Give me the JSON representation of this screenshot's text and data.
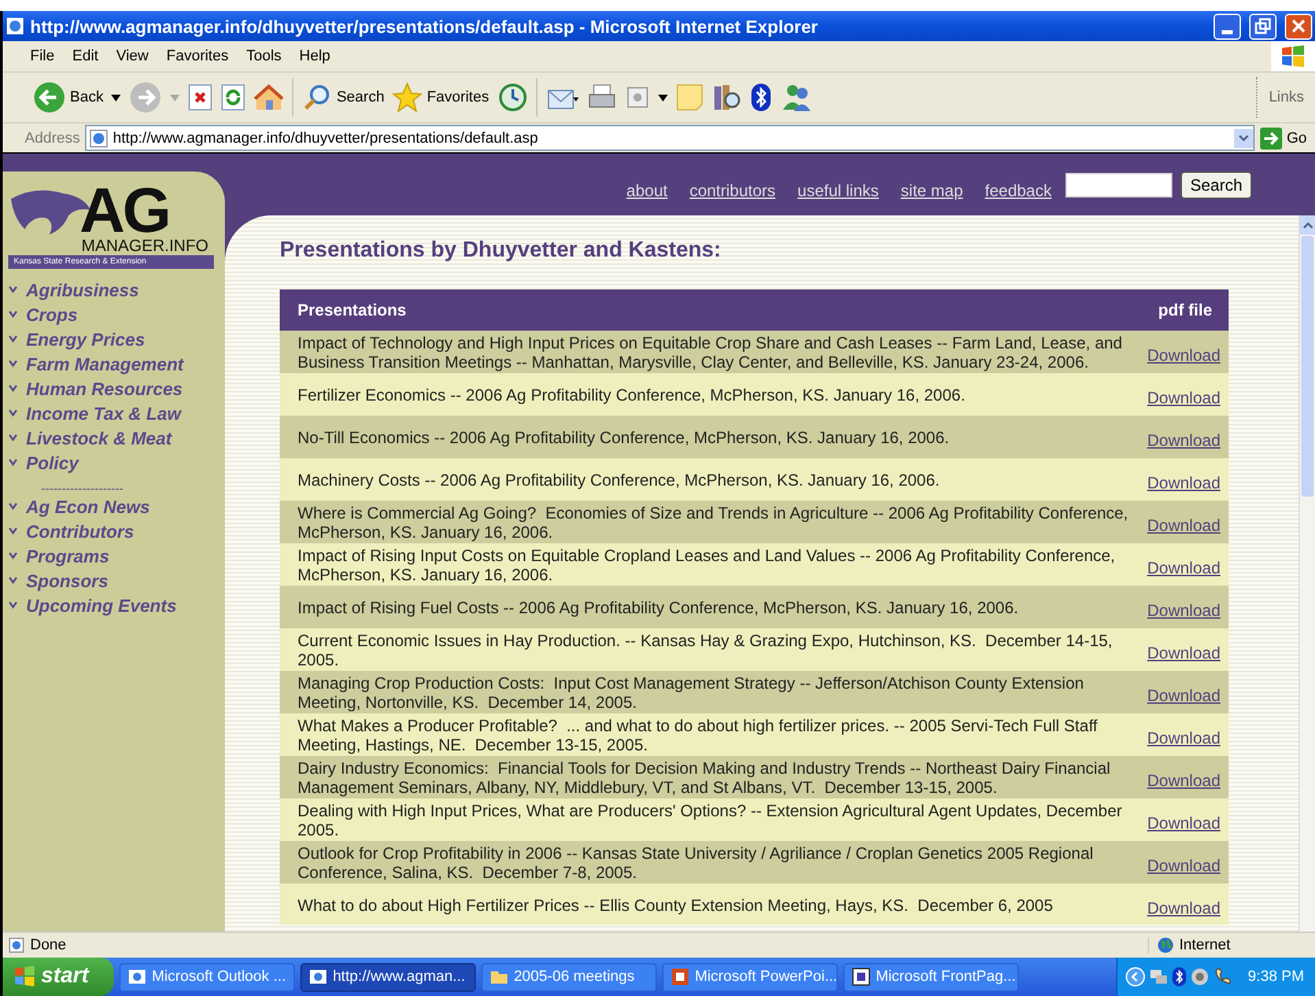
{
  "window": {
    "title": "http://www.agmanager.info/dhuyvetter/presentations/default.asp - Microsoft Internet Explorer"
  },
  "menu": [
    "File",
    "Edit",
    "View",
    "Favorites",
    "Tools",
    "Help"
  ],
  "toolbar": {
    "back": "Back",
    "search": "Search",
    "favorites": "Favorites",
    "links": "Links"
  },
  "address": {
    "label": "Address",
    "value": "http://www.agmanager.info/dhuyvetter/presentations/default.asp",
    "go": "Go"
  },
  "site": {
    "logo": {
      "title": "AG",
      "subtitle": "MANAGER.INFO",
      "tagline": "Kansas State Research & Extension"
    },
    "nav": [
      {
        "label": "Agribusiness",
        "kind": "link"
      },
      {
        "label": "Crops",
        "kind": "link"
      },
      {
        "label": "Energy Prices",
        "kind": "link"
      },
      {
        "label": "Farm Management",
        "kind": "link"
      },
      {
        "label": "Human Resources",
        "kind": "link"
      },
      {
        "label": "Income Tax & Law",
        "kind": "link"
      },
      {
        "label": "Livestock & Meat",
        "kind": "link"
      },
      {
        "label": "Policy",
        "kind": "link"
      },
      {
        "label": "--------------------",
        "kind": "separator"
      },
      {
        "label": "Ag Econ News",
        "kind": "link"
      },
      {
        "label": "Contributors",
        "kind": "link"
      },
      {
        "label": "Programs",
        "kind": "link"
      },
      {
        "label": "Sponsors",
        "kind": "link"
      },
      {
        "label": "Upcoming Events",
        "kind": "link"
      }
    ],
    "top_links": [
      "about",
      "contributors",
      "useful links",
      "site map",
      "feedback"
    ],
    "search_button": "Search",
    "heading": "Presentations by Dhuyvetter and Kastens:",
    "table": {
      "columns": [
        "Presentations",
        "pdf file"
      ],
      "rows": [
        {
          "title": "Impact of Technology and High Input Prices on Equitable Crop Share and Cash Leases -- Farm Land, Lease, and Business Transition Meetings -- Manhattan, Marysville, Clay Center, and Belleville, KS. January 23-24, 2006.",
          "link": "Download"
        },
        {
          "title": "Fertilizer Economics -- 2006 Ag Profitability Conference, McPherson, KS. January 16, 2006.",
          "link": "Download"
        },
        {
          "title": "No-Till Economics -- 2006 Ag Profitability Conference, McPherson, KS. January 16, 2006.",
          "link": "Download"
        },
        {
          "title": "Machinery Costs -- 2006 Ag Profitability Conference, McPherson, KS. January 16, 2006.",
          "link": "Download"
        },
        {
          "title": "Where is Commercial Ag Going?  Economies of Size and Trends in Agriculture -- 2006 Ag Profitability Conference, McPherson, KS. January 16, 2006.",
          "link": "Download"
        },
        {
          "title": "Impact of Rising Input Costs on Equitable Cropland Leases and Land Values -- 2006 Ag Profitability Conference, McPherson, KS. January 16, 2006.",
          "link": "Download"
        },
        {
          "title": "Impact of Rising Fuel Costs -- 2006 Ag Profitability Conference, McPherson, KS. January 16, 2006.",
          "link": "Download"
        },
        {
          "title": "Current Economic Issues in Hay Production. -- Kansas Hay & Grazing Expo, Hutchinson, KS.  December 14-15, 2005.",
          "link": "Download"
        },
        {
          "title": "Managing Crop Production Costs:  Input Cost Management Strategy -- Jefferson/Atchison County Extension Meeting, Nortonville, KS.  December 14, 2005.",
          "link": "Download"
        },
        {
          "title": "What Makes a Producer Profitable?  ... and what to do about high fertilizer prices. -- 2005 Servi-Tech Full Staff Meeting, Hastings, NE.  December 13-15, 2005.",
          "link": "Download"
        },
        {
          "title": "Dairy Industry Economics:  Financial Tools for Decision Making and Industry Trends -- Northeast Dairy Financial Management Seminars, Albany, NY, Middlebury, VT, and St Albans, VT.  December 13-15, 2005.",
          "link": "Download"
        },
        {
          "title": "Dealing with High Input Prices, What are Producers' Options? -- Extension Agricultural Agent Updates, December 2005.",
          "link": "Download"
        },
        {
          "title": "Outlook for Crop Profitability in 2006 -- Kansas State University / Agriliance / Croplan Genetics 2005 Regional Conference, Salina, KS.  December 7-8, 2005.",
          "link": "Download"
        },
        {
          "title": "What to do about High Fertilizer Prices -- Ellis County Extension Meeting, Hays, KS.  December 6, 2005",
          "link": "Download"
        }
      ]
    }
  },
  "status_bar": {
    "text": "Done",
    "zone": "Internet"
  },
  "taskbar": {
    "start": "start",
    "tasks": [
      {
        "label": "Microsoft Outlook ...",
        "kind": "mail",
        "selected": false
      },
      {
        "label": "http://www.agman...",
        "kind": "browser",
        "selected": true
      },
      {
        "label": "2005-06 meetings",
        "kind": "folder",
        "selected": false
      },
      {
        "label": "Microsoft PowerPoi...",
        "kind": "slides",
        "selected": false
      },
      {
        "label": "Microsoft FrontPag...",
        "kind": "web",
        "selected": false
      }
    ],
    "clock": "9:38 PM"
  }
}
